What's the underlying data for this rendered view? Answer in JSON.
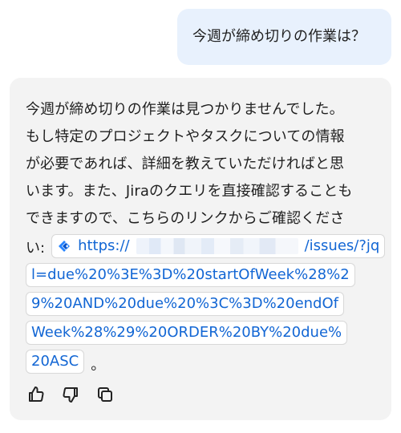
{
  "conversation": {
    "user_message": "今週が締め切りの作業は？",
    "assistant_lines": [
      "今週が締め切りの作業は見つかりませんでした。",
      "もし特定のプロジェクトやタスクについての情報",
      "が必要であれば、詳細を教えていただければと思",
      "います。また、Jiraのクエリを直接確認することも",
      "できますので、こちらのリンクからご確認くださ"
    ],
    "link_prefix": "い:",
    "link_parts": {
      "scheme": "https://",
      "path_1": "/issues/?jq",
      "line_2": "l=due%20%3E%3D%20startOfWeek%28%2",
      "line_3": "9%20AND%20due%20%3C%3D%20endOf",
      "line_4": "Week%28%29%20ORDER%20BY%20due%",
      "line_5": "20ASC"
    },
    "sentence_end": "。"
  },
  "actions": {
    "like": "thumbs-up-icon",
    "dislike": "thumbs-down-icon",
    "copy": "copy-icon"
  },
  "colors": {
    "user_bubble": "#e8f1fd",
    "card": "#f3f3f3",
    "link": "#1266d4",
    "jira": "#2684ff"
  }
}
